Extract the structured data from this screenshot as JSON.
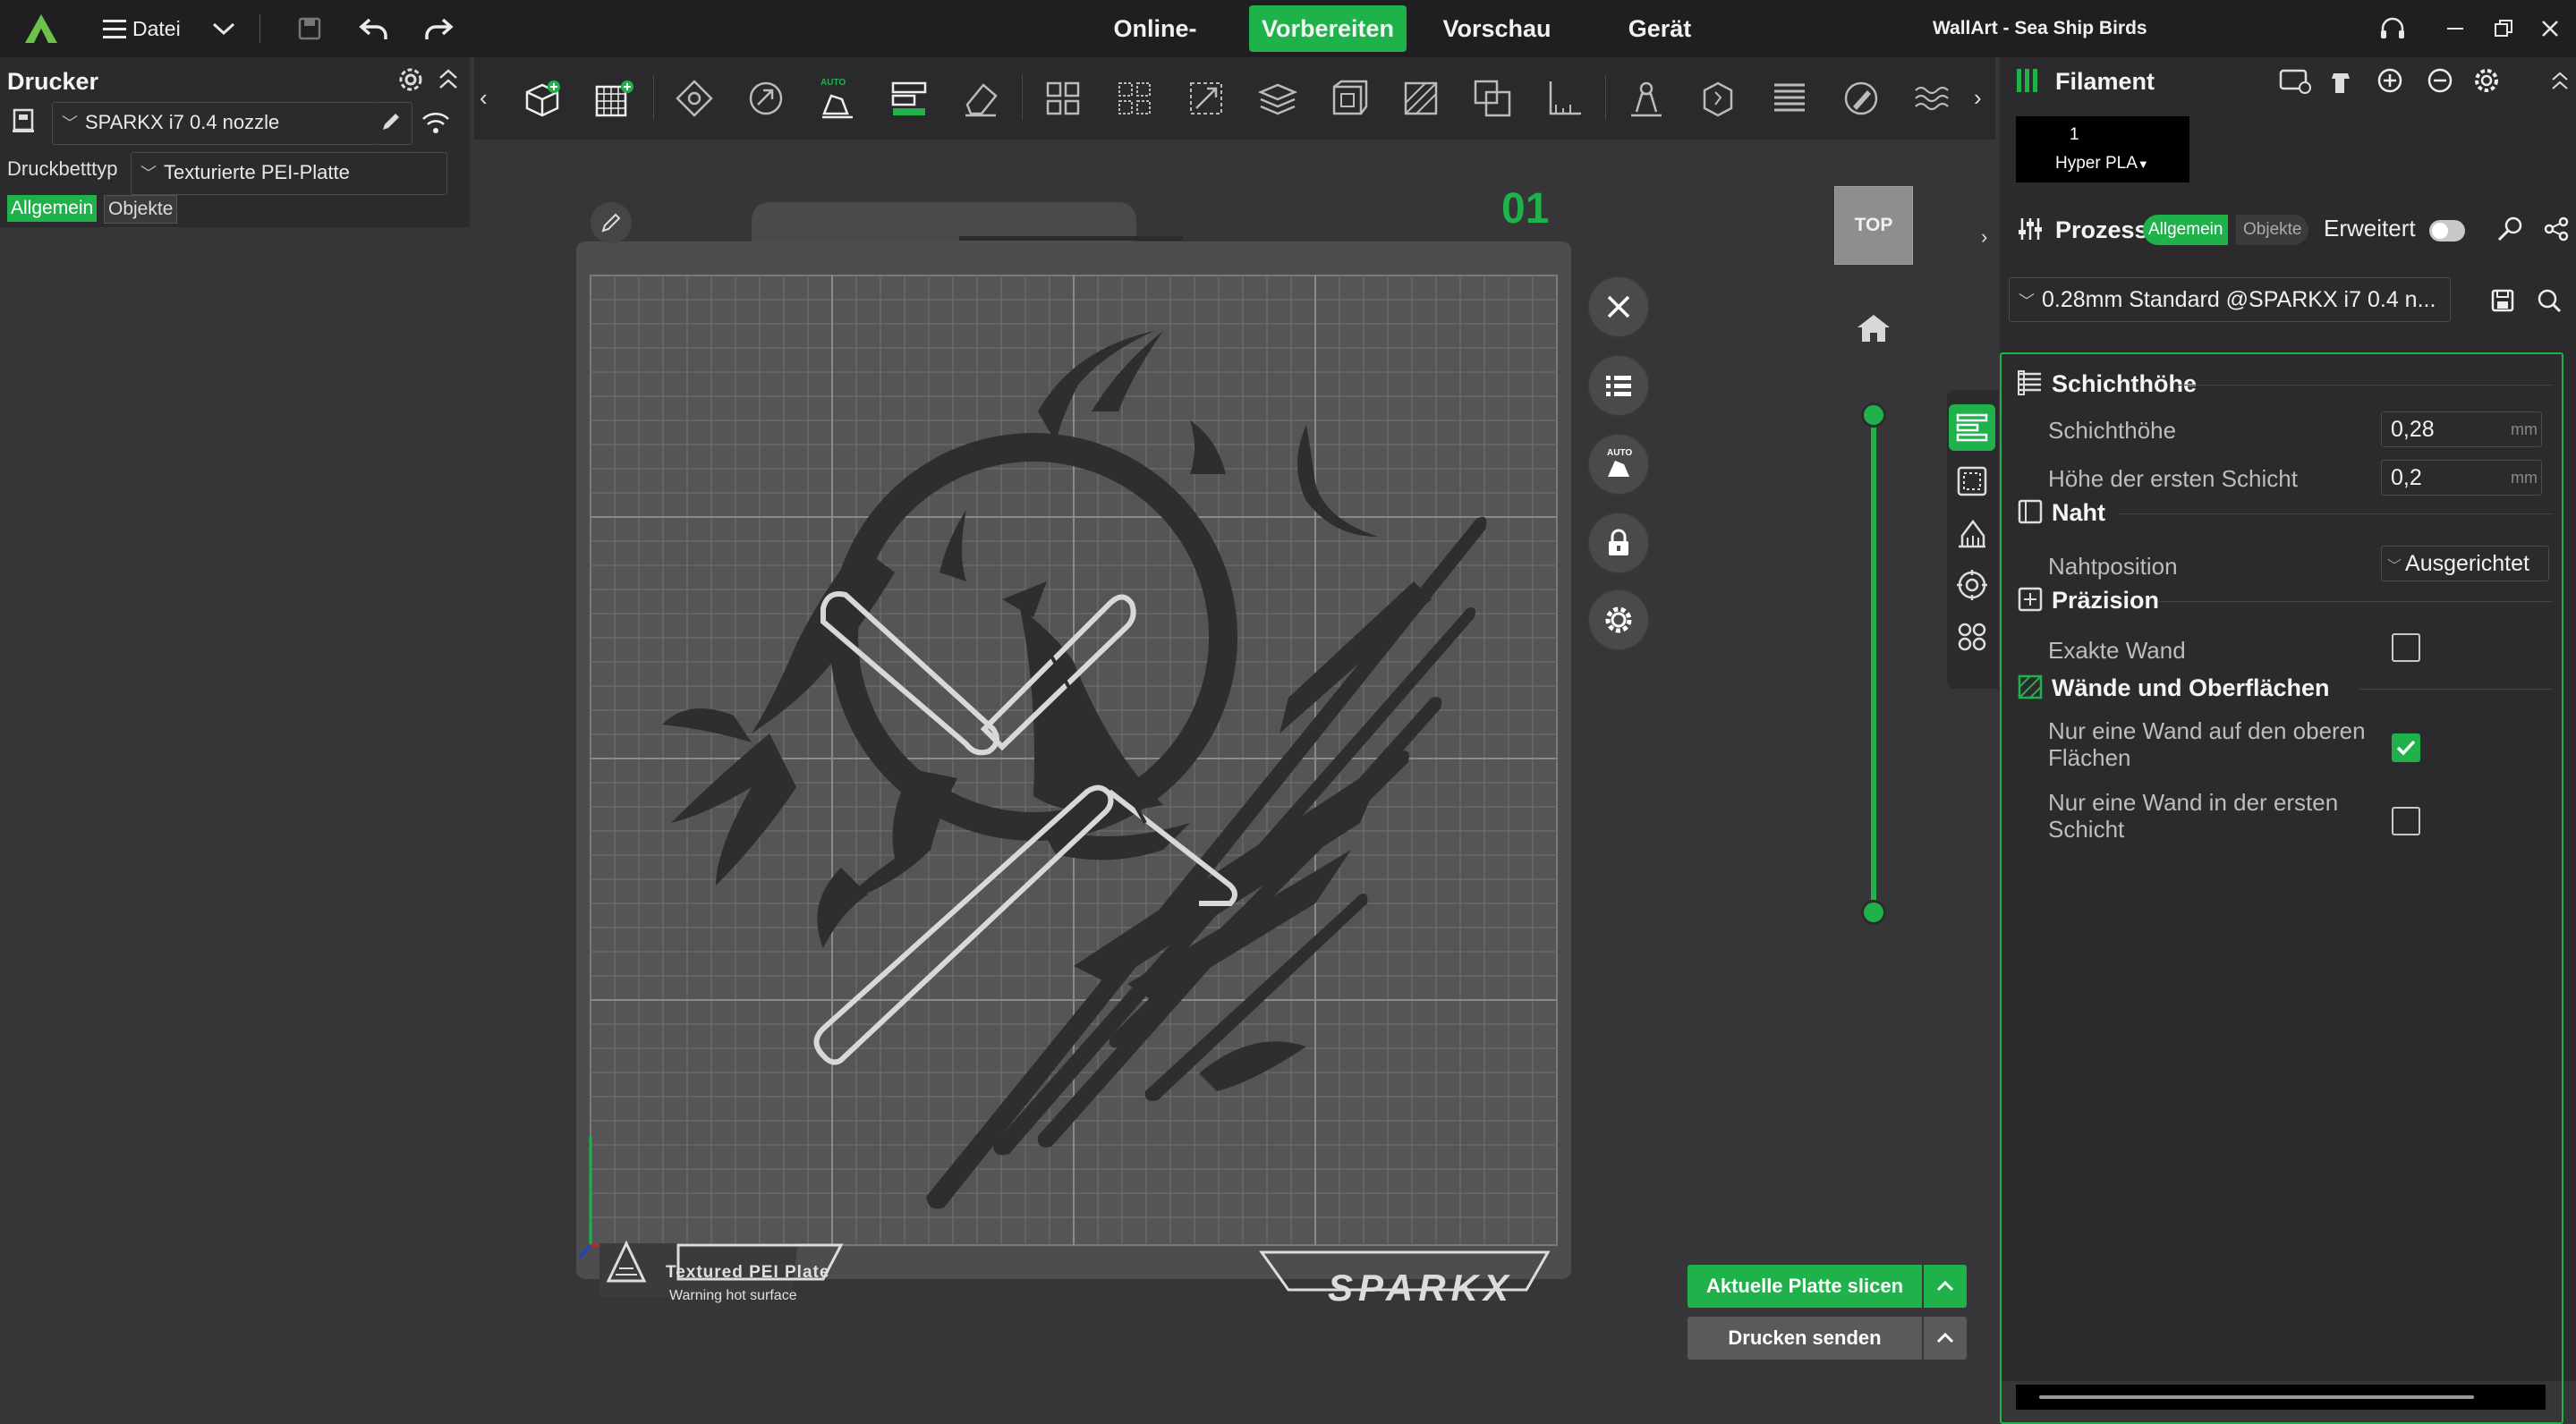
{
  "topbar": {
    "file_menu": "Datei",
    "tabs": [
      {
        "label": "Online-Modelle",
        "active": false
      },
      {
        "label": "Vorbereiten",
        "active": true
      },
      {
        "label": "Vorschau",
        "active": false
      },
      {
        "label": "Gerät",
        "active": false
      }
    ],
    "project_title": "WallArt - Sea Ship Birds"
  },
  "left_panel": {
    "title": "Drucker",
    "printer_name": "SPARKX i7 0.4 nozzle",
    "bed_type_label": "Druckbetttyp",
    "bed_type_value": "Texturierte PEI-Platte",
    "tabs": [
      "Allgemein",
      "Objekte"
    ]
  },
  "viewport": {
    "plate_number": "01",
    "view_cube_label": "TOP",
    "bed_label_title": "Textured  PEI  Plate",
    "bed_label_warning": "Warning hot surface",
    "brand_logo": "SPARKX",
    "auto_label": "AUTO",
    "slice_button": "Aktuelle Platte slicen",
    "print_button": "Drucken senden"
  },
  "right_panel": {
    "filament_title": "Filament",
    "filament_slot_number": "1",
    "filament_name": "Hyper PLA",
    "process_title": "Prozess",
    "process_tabs": [
      "Allgemein",
      "Objekte"
    ],
    "advanced_label": "Erweitert",
    "profile_name": "0.28mm Standard @SPARKX i7 0.4 n...",
    "sections": {
      "layer_height": {
        "title": "Schichthöhe",
        "layer_height_label": "Schichthöhe",
        "layer_height_value": "0,28",
        "first_layer_label": "Höhe der ersten Schicht",
        "first_layer_value": "0,2",
        "unit": "mm"
      },
      "seam": {
        "title": "Naht",
        "seam_position_label": "Nahtposition",
        "seam_position_value": "Ausgerichtet"
      },
      "precision": {
        "title": "Präzision",
        "exact_wall_label": "Exakte Wand",
        "exact_wall_checked": false
      },
      "walls": {
        "title": "Wände und Oberflächen",
        "one_wall_top_label": "Nur eine Wand auf den oberen Flächen",
        "one_wall_top_checked": true,
        "one_wall_first_label": "Nur eine Wand in der ersten Schicht",
        "one_wall_first_checked": false
      }
    }
  },
  "colors": {
    "accent": "#1fb24a",
    "background": "#363638",
    "panel": "#2b2b2d",
    "topbar": "#1f1f21"
  }
}
